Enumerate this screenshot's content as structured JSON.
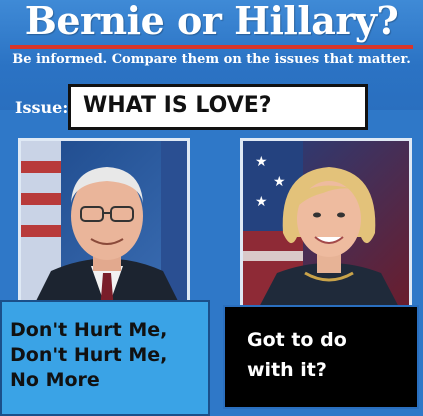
{
  "header": {
    "title": "Bernie or Hillary?",
    "subtitle": "Be informed. Compare them on the issues that matter."
  },
  "issue": {
    "label": "Issue:",
    "text": "WHAT IS LOVE?"
  },
  "candidates": [
    {
      "name": "Bernie",
      "icon": "portrait-bernie"
    },
    {
      "name": "Hillary",
      "icon": "portrait-hillary"
    }
  ],
  "answers": {
    "left": [
      "Don't Hurt Me,",
      "Don't Hurt Me,",
      "No More"
    ],
    "right": [
      "Got to do",
      "with it?"
    ]
  },
  "colors": {
    "background": "#2f78c8",
    "accent_red": "#d8362b",
    "left_box": "#3aa3e6",
    "right_box": "#000000"
  }
}
